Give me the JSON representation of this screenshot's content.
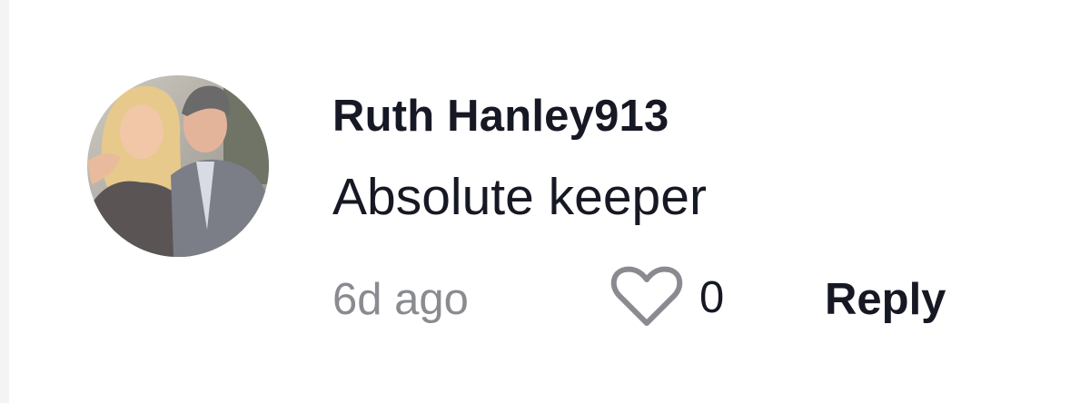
{
  "comment": {
    "username": "Ruth Hanley913",
    "text": "Absolute keeper",
    "timestamp": "6d ago",
    "like_count": "0",
    "reply_label": "Reply",
    "like_icon": "heart-outline-icon"
  },
  "colors": {
    "primary_text": "#161823",
    "secondary_text": "#8a8b91",
    "icon_stroke": "#8a8b91"
  }
}
